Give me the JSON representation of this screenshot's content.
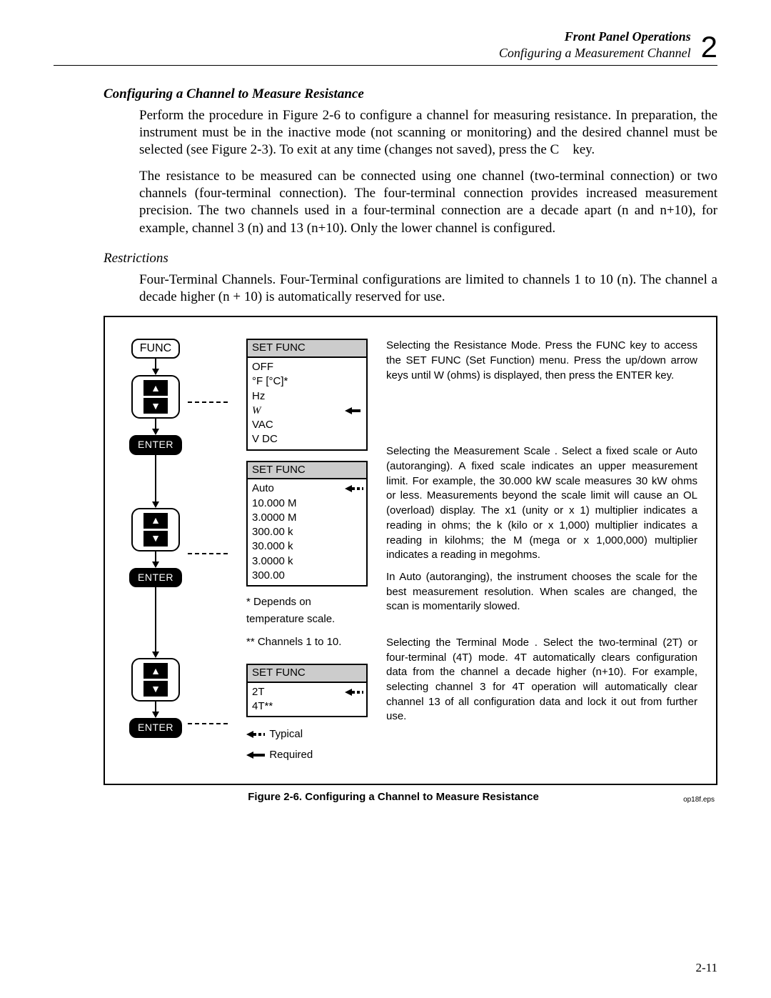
{
  "header": {
    "section": "Front Panel Operations",
    "subsection": "Configuring a Measurement Channel",
    "chapter": "2"
  },
  "h1": "Configuring a Channel to Measure Resistance",
  "p1": "Perform the procedure in Figure 2-6 to configure a channel for measuring resistance. In preparation, the instrument must be in the inactive mode (not scanning or monitoring) and the desired channel must be selected (see Figure 2-3). To exit at any time (changes not saved), press the C    key.",
  "p2": "The resistance to be measured can be connected using one channel (two-terminal connection) or two channels (four-terminal connection). The four-terminal connection provides increased measurement precision. The two channels used in a four-terminal connection are a decade apart (n and n+10), for example, channel 3 (n) and 13 (n+10). Only the lower channel is configured.",
  "h2": "Restrictions",
  "p3": "Four-Terminal Channels. Four-Terminal configurations are limited to channels 1 to 10 (n). The channel a decade higher (n + 10) is automatically reserved for use.",
  "flow": {
    "func_key": "FUNC",
    "enter_key": "ENTER",
    "menu1": {
      "title": "SET FUNC",
      "items": [
        "OFF",
        "°F [°C]*",
        "Hz",
        "W",
        "VAC",
        "V DC"
      ],
      "selected_index": 3
    },
    "menu2": {
      "title": "SET FUNC",
      "items": [
        "Auto",
        "10.000 M",
        "3.0000 M",
        "300.00 k",
        "30.000 k",
        "3.0000 k",
        "300.00"
      ],
      "selected_index": 0
    },
    "menu3": {
      "title": "SET FUNC",
      "items": [
        "2T",
        "4T**"
      ],
      "selected_index": 0
    },
    "note1": "*  Depends on temperature scale.",
    "note2": "** Channels 1 to 10.",
    "legend_typical": "Typical",
    "legend_required": "Required"
  },
  "desc1_title": "Selecting the Resistance Mode",
  "desc1": ".  Press the FUNC key to access the SET FUNC (Set Function) menu.  Press the up/down arrow keys until  W (ohms) is displayed, then press the ENTER key.",
  "desc2_title": "Selecting the Measurement Scale",
  "desc2": " .  Select a fixed scale or Auto (autoranging).  A fixed scale indicates an upper measurement limit.  For example, the 30.000 kW scale measures 30 kW ohms or less.  Measurements beyond the scale limit will cause an OL (overload) display.  The x1 (unity or x 1) multiplier indicates a reading in ohms; the k (kilo or x 1,000) multiplier indicates a reading in kilohms; the M (mega or x 1,000,000) multiplier indicates a reading in megohms.",
  "desc2b": "In Auto (autoranging), the instrument chooses the scale for the best measurement resolution.  When scales are changed, the scan is momentarily slowed.",
  "desc3_title": "Selecting the Terminal Mode",
  "desc3": " .  Select the two-terminal (2T) or four-terminal (4T) mode.  4T automatically clears configuration data from the channel a decade higher (n+10).  For example, selecting channel 3 for 4T operation will automatically clear channel 13 of all configuration data and lock it out from further use.",
  "fig_eps": "op18f.eps",
  "fig_caption": "Figure 2-6. Configuring a Channel to Measure Resistance",
  "page_num": "2-11"
}
